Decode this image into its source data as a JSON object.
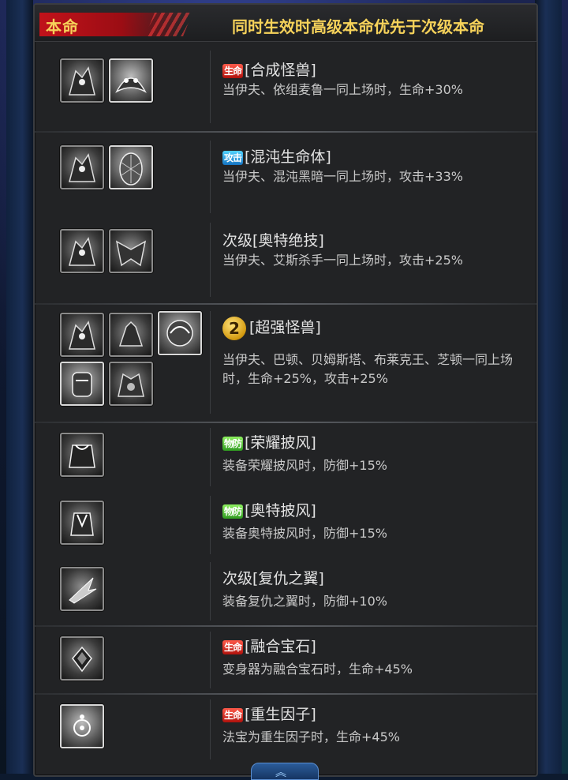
{
  "header": {
    "tag": "本命",
    "note": "同时生效时高级本命优先于次级本命"
  },
  "entries": [
    {
      "badge": "生命",
      "badge_type": "life",
      "title": "[合成怪兽]",
      "desc": "当伊夫、依组麦鲁一同上场时，生命+30%",
      "icons": [
        "monster-a-icon",
        "monster-b-icon"
      ]
    },
    {
      "badge": "攻击",
      "badge_type": "atk",
      "title": "[混沌生命体]",
      "desc": "当伊夫、混沌黑暗一同上场时，攻击+33%",
      "icons": [
        "monster-a-icon",
        "monster-c-icon"
      ]
    },
    {
      "badge": "",
      "badge_type": "",
      "title": "次级[奥特绝技]",
      "desc": "当伊夫、艾斯杀手一同上场时，攻击+25%",
      "icons": [
        "monster-a-icon",
        "monster-d-icon"
      ]
    },
    {
      "badge": "2",
      "badge_type": "num",
      "title": "[超强怪兽]",
      "desc": "当伊夫、巴顿、贝姆斯塔、布莱克王、芝顿一同上场时，生命+25%，攻击+25%",
      "icons": [
        "monster-a-icon",
        "monster-e-icon",
        "monster-f-icon",
        "monster-g-icon",
        "monster-h-icon"
      ]
    },
    {
      "badge": "物防",
      "badge_type": "def",
      "title": "[荣耀披风]",
      "desc": "装备荣耀披风时，防御+15%",
      "icons": [
        "cape-icon"
      ]
    },
    {
      "badge": "物防",
      "badge_type": "def",
      "title": "[奥特披风]",
      "desc": "装备奥特披风时，防御+15%",
      "icons": [
        "ultra-cape-icon"
      ]
    },
    {
      "badge": "",
      "badge_type": "",
      "title": "次级[复仇之翼]",
      "desc": "装备复仇之翼时，防御+10%",
      "icons": [
        "wing-icon"
      ]
    },
    {
      "badge": "生命",
      "badge_type": "life",
      "title": "[融合宝石]",
      "desc": "变身器为融合宝石时，生命+45%",
      "icons": [
        "gem-icon"
      ]
    },
    {
      "badge": "生命",
      "badge_type": "life",
      "title": "[重生因子]",
      "desc": "法宝为重生因子时，生命+45%",
      "icons": [
        "factor-icon"
      ]
    }
  ],
  "footer": {
    "tab_glyph": "︽"
  }
}
